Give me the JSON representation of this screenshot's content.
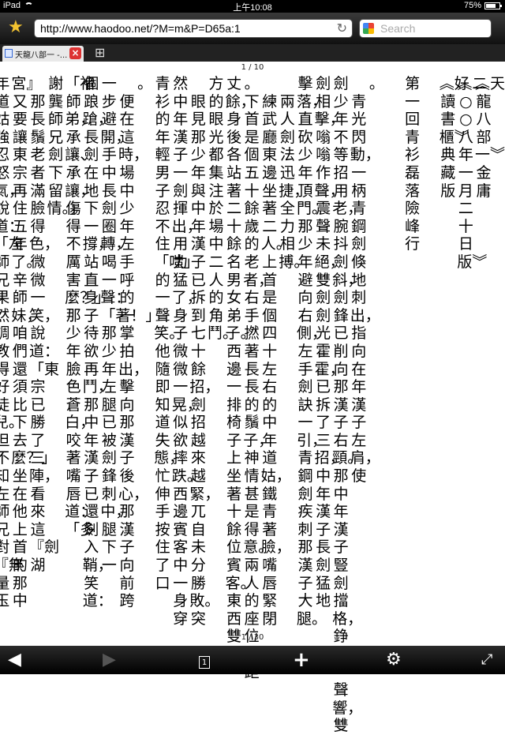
{
  "status": {
    "device": "iPad",
    "time": "上午10:08",
    "battery": "75%",
    "battery_level": 0.75
  },
  "toolbar": {
    "url": "http://www.haodoo.net/?M=m&P=D65a:1",
    "search_placeholder": "Search"
  },
  "tabs": [
    {
      "title": "天龍八部一 -..."
    }
  ],
  "page": {
    "top_indicator": "1 / 10",
    "bottom_indicator": "1 / 30",
    "columns": [
      "︽天龍八部一︾金庸",
      "︽二○○八年一月二十日版︾",
      "︽好讀書櫃︾典藏版",
      "",
      "第一回　青衫磊落險峰行",
      "",
      "。",
      "　青光閃動，一柄青鋼劍倏地刺出，指向在年漢子左肩，使",
      "劍少年不等招用老，腕抖劍斜，劍鋒已削向那漢子右頸。那中年漢子豎劍擋格，錚的一聲響，雙",
      "劍相擊，嗡嗡作聲，震聲未絕，雙劍劍光霍霍，已拆了三招，中年漢子長劍猛地",
      "擊落，直砍少年頂門。那少年避向右側，左手劍訣一引，青鋼劍疾刺那漢子大腿。",
      "　兩人劍法迅捷，全力相搏。",
      "　練武廳東邊坐著二人。上首是個四十左右的中年道姑，鐵青著臉，嘴唇緊閉",
      "。下首是個五十餘歲的老者，右手撚著長長的鬚子，神情甚是得意。兩人的座位相距",
      "丈餘，身後各站著二十餘名男女弟子。西邊一排椅子上坐著十餘位賓客。東西雙",
      "方的眼光都集注於場中二人的角鬥。",
      "　眼見那少年與中年漢子已拆到七十餘招，劍招越來越緊，兀自未分勝敗。突",
      "然中年漢子一劍揮出，用力猛了，身子微微一晃，似欲摔跌。西邊賓客中一身穿",
      "青衫的年輕男子忍不住「嗤」的一聲笑。他隨即知道失態，忙伸手按住了口",
      "。",
      "　便在這時，場中少年左手呼的一掌拍出，擊向那漢子後心，那漢子向前跨",
      "一步避開，手中長劍圈轉，喝一聲：「著！」那少年左腿已被劍鋒刺中，腿下一",
      "個踉蹌，長劍在地下一撐，站直身子待欲再鬥，那中年漢子已還劍入鞘，笑道：",
      "「褚師弟，承讓、承讓，傷得不厲害麼？」那少年臉色蒼白，咬著嘴唇道：「多",
      "謝龔師兄劍下留情。」",
      "　那長鬚老者滿臉得色，微微一笑，說道：「東宗已勝了三陣，看來這『劍湖",
      "宮』又要讓東宗再住五年了。辛師妹，咱們還須比下去麼？」坐在他上首的那中",
      "年道姑強忍怒氣，說道：「左師兄果然調教得好徒兒。但不知左師兄對『無量玉"
    ]
  }
}
